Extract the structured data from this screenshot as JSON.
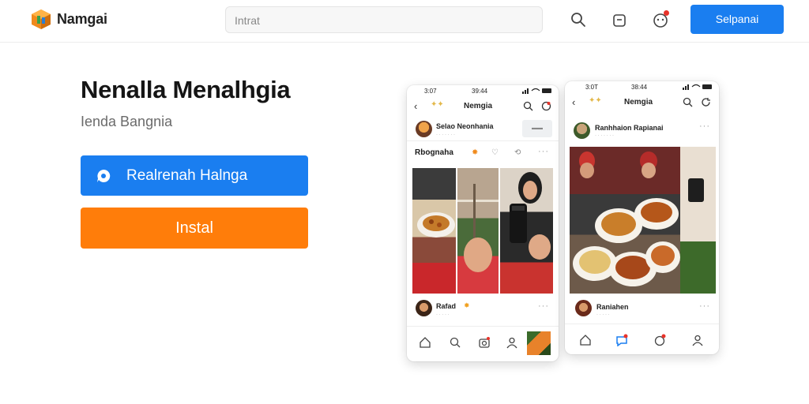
{
  "app": {
    "name": "Namgai"
  },
  "search": {
    "placeholder": "Intrat"
  },
  "header": {
    "cta_label": "Selpanai"
  },
  "hero": {
    "title": "Nenalla Menalhgia",
    "subtitle": "Ienda Bangnia",
    "primary_button": "Realrenah Halnga",
    "install_button": "Instal"
  },
  "colors": {
    "accent_blue": "#1a7ef0",
    "install_orange": "#ff7d0a",
    "badge_red": "#e8332a"
  },
  "phone_left": {
    "status_time": "3:07",
    "status_center": "39:44",
    "app_title": "Nemgia",
    "user_name": "Selao Neonhania",
    "follow_label": "",
    "caption": "Rbognaha",
    "footer_user": "Rafad",
    "icons": [
      "back-icon",
      "star-icon",
      "search-icon",
      "refresh-icon",
      "home-icon",
      "search-icon",
      "camera-icon",
      "profile-icon"
    ]
  },
  "phone_right": {
    "status_time": "3:0T",
    "status_center": "38:44",
    "app_title": "Nemgia",
    "user_name": "Ranhhaion Rapianai",
    "footer_user": "Raniahen",
    "icons": [
      "back-icon",
      "star-icon",
      "search-icon",
      "refresh-icon",
      "home-icon",
      "chat-icon",
      "notification-icon",
      "profile-icon"
    ]
  }
}
